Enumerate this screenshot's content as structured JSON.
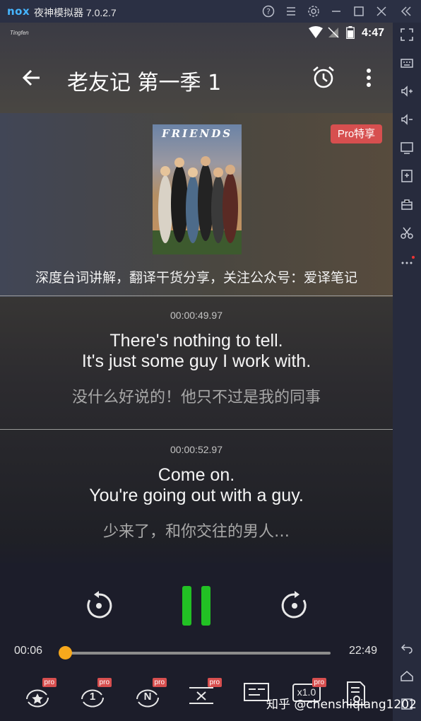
{
  "emulator": {
    "logo": "nox",
    "title": "夜神模拟器 7.0.2.7",
    "titlebar_icons": [
      "help-icon",
      "menu-icon",
      "settings-icon",
      "minimize-icon",
      "maximize-icon",
      "close-icon",
      "collapse-icon"
    ],
    "sidebar_icons": [
      "fullscreen-icon",
      "keyboard-icon",
      "volume-up-icon",
      "volume-down-icon",
      "screen-icon",
      "apk-install-icon",
      "toolbox-icon",
      "scissors-icon",
      "more-icon",
      "back-nav-icon",
      "home-nav-icon",
      "recent-nav-icon"
    ]
  },
  "statusbar": {
    "app_label": "Tingfen",
    "time": "4:47"
  },
  "appbar": {
    "title": "老友记 第一季 1"
  },
  "cover": {
    "poster_title": "FRIENDS",
    "pro_badge": "Pro特享",
    "caption": "深度台词讲解，翻译干货分享，关注公众号：爱译笔记"
  },
  "cues": [
    {
      "timestamp": "00:00:49.97",
      "en_line1": "There's nothing to tell.",
      "en_line2": "It's just some guy I work with.",
      "zh": "没什么好说的！他只不过是我的同事"
    },
    {
      "timestamp": "00:00:52.97",
      "en_line1": "Come on.",
      "en_line2": "You're going out with a guy.",
      "zh": "少来了，和你交往的男人…"
    }
  ],
  "player": {
    "current_time": "00:06",
    "total_time": "22:49",
    "progress_fraction": 0.004,
    "accent_color": "#22c124",
    "progress_color": "#f7a81c"
  },
  "toolbar": {
    "pro_label": "pro",
    "single_loop_label": "1",
    "n_loop_label": "N",
    "speed_label": "x1.0"
  },
  "watermark": "知乎 @chenshiqiang1202"
}
